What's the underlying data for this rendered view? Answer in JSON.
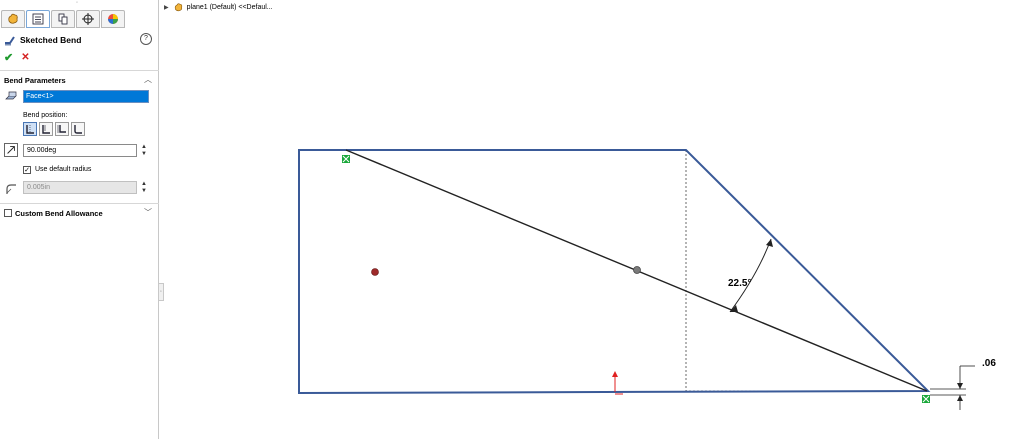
{
  "panel": {
    "title": "Sketched Bend",
    "help": "?",
    "ok": "✔",
    "cancel": "✕",
    "bend_parameters": {
      "title": "Bend Parameters",
      "face_selection": "Face<1>",
      "bend_position_label": "Bend position:",
      "angle_value": "90.00deg",
      "use_default_radius_label": "Use default radius",
      "use_default_radius_checked": true,
      "radius_value": "0.005in"
    },
    "custom_bend_allowance": {
      "title": "Custom Bend Allowance",
      "checked": false
    }
  },
  "tree": {
    "item": "plane1 (Default) <<Defaul..."
  },
  "drawing": {
    "angle_dimension": "22.5°",
    "thickness_dimension": ".06",
    "edge_color": "#3a5a98",
    "bend_line_color": "#222222"
  }
}
